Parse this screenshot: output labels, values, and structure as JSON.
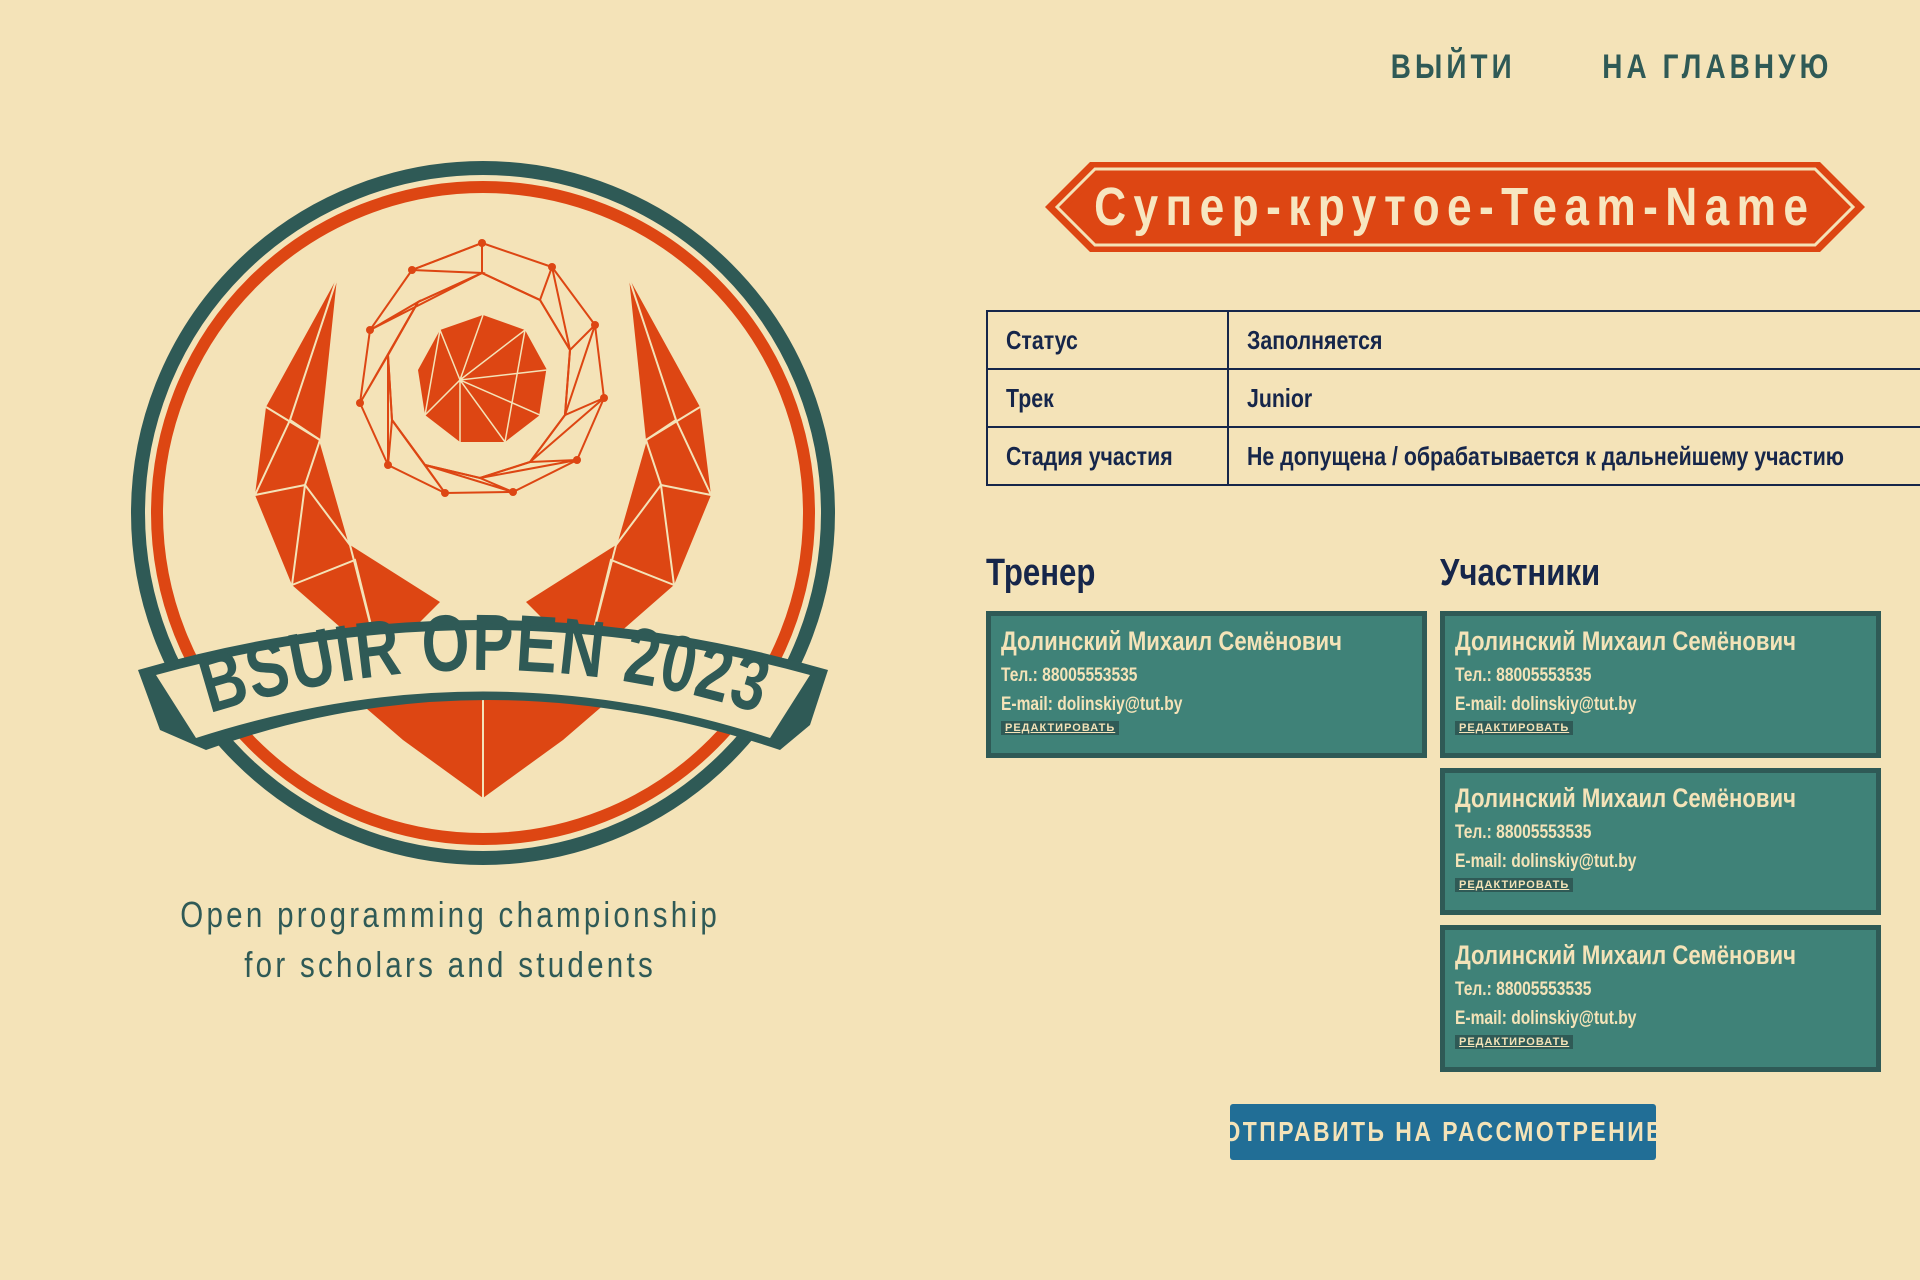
{
  "nav": {
    "logout_label": "ВЫЙТИ",
    "home_label": "НА ГЛАВНУЮ"
  },
  "logo": {
    "text": "BSUIR OPEN 2023"
  },
  "tagline": {
    "line1": "Open programming championship",
    "line2": "for scholars and students"
  },
  "team": {
    "name": "Супер-крутое-Team-Name"
  },
  "info_table": {
    "rows": [
      {
        "label": "Статус",
        "value": "Заполняется"
      },
      {
        "label": "Трек",
        "value": "Junior"
      },
      {
        "label": "Стадия участия",
        "value": "Не допущена / обрабатывается к дальнейшему участию"
      }
    ]
  },
  "coach": {
    "title": "Тренер",
    "name": "Долинский Михаил Семёнович",
    "phone": "Тел.: 88005553535",
    "email": "E-mail: dolinskiy@tut.by",
    "edit_label": "РЕДАКТИРОВАТЬ"
  },
  "participants": {
    "title": "Участники",
    "items": [
      {
        "name": "Долинский Михаил Семёнович",
        "phone": "Тел.: 88005553535",
        "email": "E-mail: dolinskiy@tut.by",
        "edit_label": "РЕДАКТИРОВАТЬ"
      },
      {
        "name": "Долинский Михаил Семёнович",
        "phone": "Тел.: 88005553535",
        "email": "E-mail: dolinskiy@tut.by",
        "edit_label": "РЕДАКТИРОВАТЬ"
      },
      {
        "name": "Долинский Михаил Семёнович",
        "phone": "Тел.: 88005553535",
        "email": "E-mail: dolinskiy@tut.by",
        "edit_label": "РЕДАКТИРОВАТЬ"
      }
    ]
  },
  "submit": {
    "label": "ОТПРАВИТЬ НА РАССМОТРЕНИЕ"
  },
  "colors": {
    "background": "#f4e3b8",
    "teal_dark": "#2f5a56",
    "teal_card": "#3f8278",
    "orange": "#dd4613",
    "navy": "#16264a",
    "button_blue": "#216e96"
  }
}
